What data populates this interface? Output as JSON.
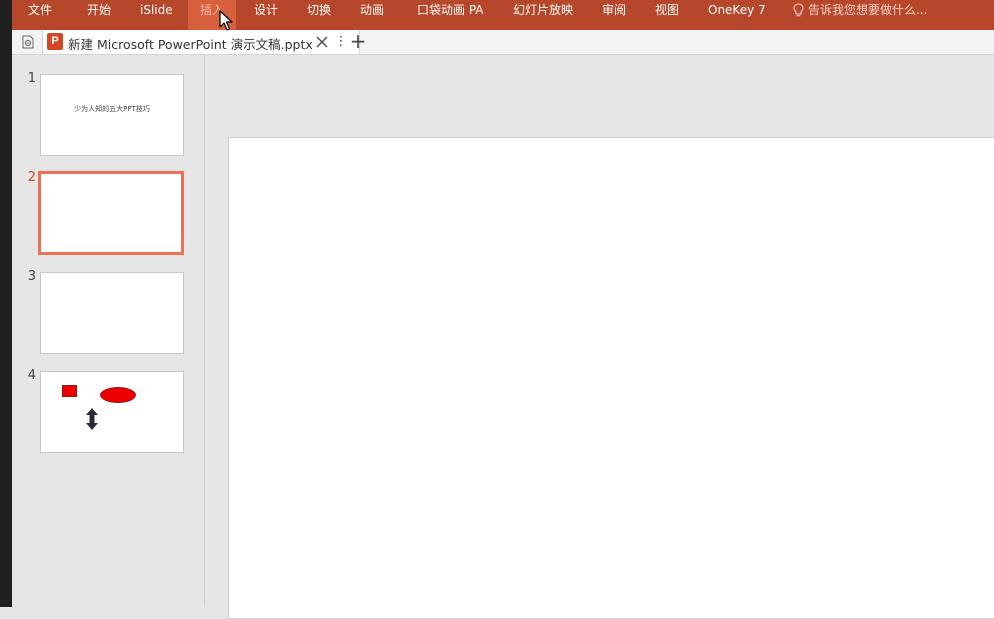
{
  "menu": {
    "items": [
      {
        "label": "文件"
      },
      {
        "label": "开始"
      },
      {
        "label": "iSlide"
      },
      {
        "label": "插入",
        "active": true
      },
      {
        "label": "设计"
      },
      {
        "label": "切换"
      },
      {
        "label": "动画"
      },
      {
        "label": "口袋动画 PA"
      },
      {
        "label": "幻灯片放映"
      },
      {
        "label": "审阅"
      },
      {
        "label": "视图"
      },
      {
        "label": "OneKey 7"
      }
    ],
    "tell_me": "告诉我您想要做什么..."
  },
  "tabs": {
    "doc_title": "新建 Microsoft PowerPoint 演示文稿.pptx",
    "app_icon_letter": "P",
    "more_glyph": "⋮",
    "add_glyph": "+"
  },
  "slides": [
    {
      "number": "1",
      "text": "少为人知的五大PPT技巧"
    },
    {
      "number": "2",
      "text": "",
      "selected": true
    },
    {
      "number": "3",
      "text": ""
    },
    {
      "number": "4",
      "text": ""
    }
  ],
  "colors": {
    "ribbon": "#b7472a",
    "accent": "#d24726",
    "selection_border": "#ec7052",
    "shape_fill": "#ee0000"
  }
}
